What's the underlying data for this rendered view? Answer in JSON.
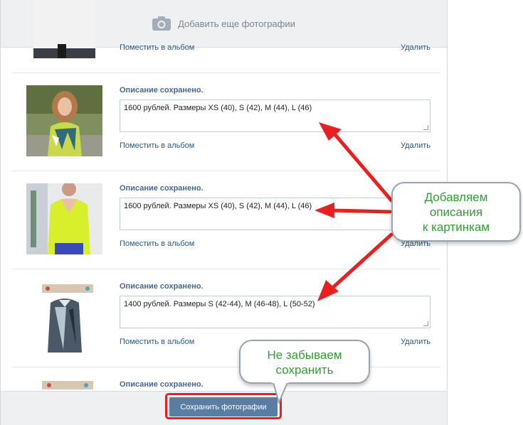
{
  "header": {
    "add_photos_label": "Добавить еще фотографии"
  },
  "rows": [
    {
      "status": "",
      "description": "",
      "album_link": "Поместить в альбом",
      "delete_link": "Удалить"
    },
    {
      "status": "Описание сохранено.",
      "description": "1600 рублей. Размеры XS (40), S (42), M (44), L (46)",
      "album_link": "Поместить в альбом",
      "delete_link": "Удалить"
    },
    {
      "status": "Описание сохранено.",
      "description": "1600 рублей. Размеры XS (40), S (42), M (44), L (46)",
      "album_link": "Поместить в альбом",
      "delete_link": "Удалить"
    },
    {
      "status": "Описание сохранено.",
      "description": "1400 рублей. Размеры S (42-44), M (46-48), L (50-52)",
      "album_link": "Поместить в альбом",
      "delete_link": "Удалить"
    },
    {
      "status": "Описание сохранено.",
      "description": "",
      "album_link": "",
      "delete_link": ""
    }
  ],
  "footer": {
    "save_label": "Сохранить фотографии"
  },
  "callouts": {
    "descriptions_line1": "Добавляем",
    "descriptions_line2": "описания",
    "descriptions_line3": "к картинкам",
    "save_line1": "Не забываем",
    "save_line2": "сохранить"
  },
  "colors": {
    "accent_blue": "#597da3",
    "link_blue": "#2b587a",
    "status_blue": "#45688e",
    "arrow_red": "#e82020",
    "callout_green": "#2fa02f"
  }
}
